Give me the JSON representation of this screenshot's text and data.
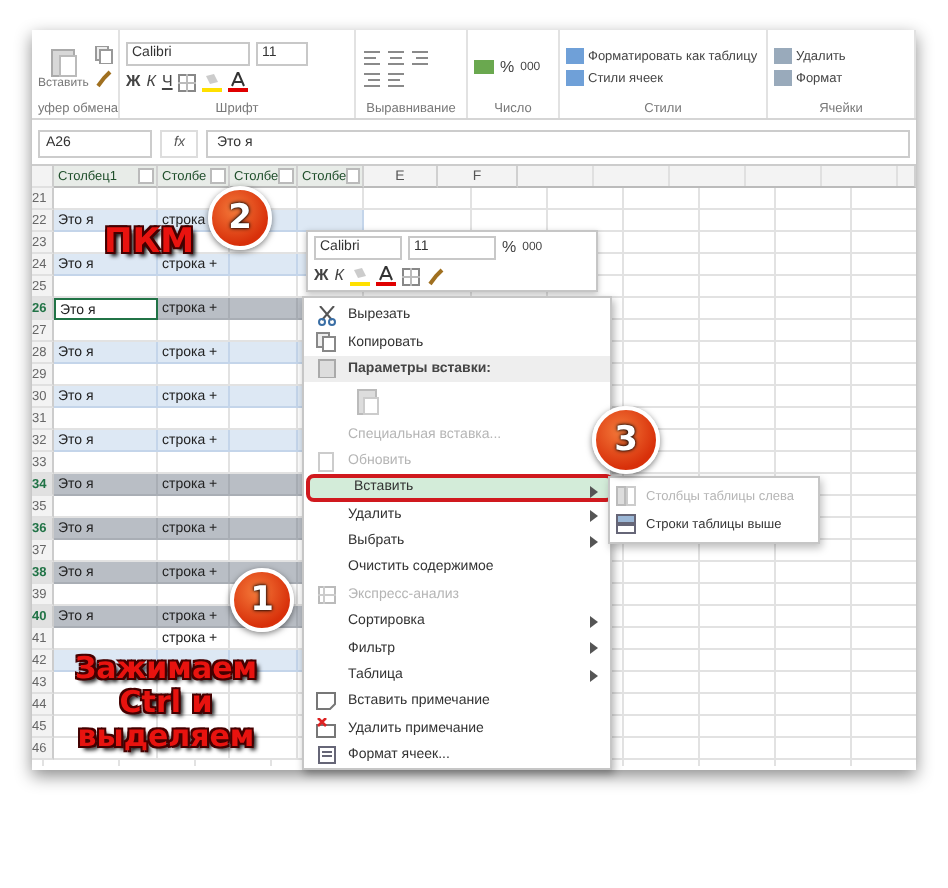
{
  "ribbon": {
    "clipboard": {
      "paste": "Вставить",
      "group": "уфер обмена"
    },
    "font": {
      "name": "Calibri",
      "size": "11",
      "bold": "Ж",
      "italic": "К",
      "underline": "Ч",
      "group": "Шрифт"
    },
    "alignment": {
      "group": "Выравнивание"
    },
    "number": {
      "percent": "%",
      "thousands": "000",
      "group": "Число"
    },
    "styles": {
      "items": [
        "Форматировать как таблицу",
        "Стили ячеек"
      ],
      "group": "Стили"
    },
    "cells": {
      "items": [
        "Удалить",
        "Формат"
      ],
      "group": "Ячейки"
    }
  },
  "formula_bar": {
    "name_box": "A26",
    "fx": "fx",
    "value": "Это я"
  },
  "sheet": {
    "columns": [
      {
        "label": "Столбец1",
        "filter": true
      },
      {
        "label": "Столбе",
        "filter": true
      },
      {
        "label": "Столбе",
        "filter": true
      },
      {
        "label": "Столбе",
        "filter": true
      },
      {
        "label": "E",
        "filter": false
      },
      {
        "label": "F",
        "filter": false
      }
    ],
    "rows": [
      {
        "number": "21",
        "cells": [
          "",
          ""
        ],
        "band": false,
        "selected": false,
        "active": false
      },
      {
        "number": "22",
        "cells": [
          "Это я",
          "строка"
        ],
        "band": true,
        "selected": false,
        "active": false
      },
      {
        "number": "23",
        "cells": [
          "",
          ""
        ],
        "band": false,
        "selected": false,
        "active": false
      },
      {
        "number": "24",
        "cells": [
          "Это я",
          "строка +"
        ],
        "band": true,
        "selected": false,
        "active": false
      },
      {
        "number": "25",
        "cells": [
          "",
          ""
        ],
        "band": false,
        "selected": false,
        "active": false
      },
      {
        "number": "26",
        "cells": [
          "Это я",
          "строка +"
        ],
        "band": true,
        "selected": true,
        "active": true
      },
      {
        "number": "27",
        "cells": [
          "",
          ""
        ],
        "band": false,
        "selected": false,
        "active": false
      },
      {
        "number": "28",
        "cells": [
          "Это я",
          "строка +"
        ],
        "band": true,
        "selected": false,
        "active": false
      },
      {
        "number": "29",
        "cells": [
          "",
          ""
        ],
        "band": false,
        "selected": false,
        "active": false
      },
      {
        "number": "30",
        "cells": [
          "Это я",
          "строка +"
        ],
        "band": true,
        "selected": false,
        "active": false
      },
      {
        "number": "31",
        "cells": [
          "",
          ""
        ],
        "band": false,
        "selected": false,
        "active": false
      },
      {
        "number": "32",
        "cells": [
          "Это я",
          "строка +"
        ],
        "band": true,
        "selected": false,
        "active": false
      },
      {
        "number": "33",
        "cells": [
          "",
          ""
        ],
        "band": false,
        "selected": false,
        "active": false
      },
      {
        "number": "34",
        "cells": [
          "Это я",
          "строка +"
        ],
        "band": true,
        "selected": true,
        "active": false
      },
      {
        "number": "35",
        "cells": [
          "",
          ""
        ],
        "band": false,
        "selected": false,
        "active": false
      },
      {
        "number": "36",
        "cells": [
          "Это я",
          "строка +"
        ],
        "band": true,
        "selected": true,
        "active": false
      },
      {
        "number": "37",
        "cells": [
          "",
          ""
        ],
        "band": false,
        "selected": false,
        "active": false
      },
      {
        "number": "38",
        "cells": [
          "Это я",
          "строка +"
        ],
        "band": true,
        "selected": true,
        "active": false
      },
      {
        "number": "39",
        "cells": [
          "",
          ""
        ],
        "band": false,
        "selected": false,
        "active": false
      },
      {
        "number": "40",
        "cells": [
          "Это я",
          "строка +"
        ],
        "band": true,
        "selected": true,
        "active": false
      },
      {
        "number": "41",
        "cells": [
          "",
          "строка +"
        ],
        "band": false,
        "selected": false,
        "active": false
      },
      {
        "number": "42",
        "cells": [
          "",
          ""
        ],
        "band": true,
        "selected": false,
        "active": false
      },
      {
        "number": "43",
        "cells": [
          "",
          ""
        ],
        "band": false,
        "selected": false,
        "active": false
      },
      {
        "number": "44",
        "cells": [
          "",
          ""
        ],
        "band": false,
        "selected": false,
        "active": false
      },
      {
        "number": "45",
        "cells": [
          "",
          ""
        ],
        "band": false,
        "selected": false,
        "active": false
      },
      {
        "number": "46",
        "cells": [
          "",
          ""
        ],
        "band": false,
        "selected": false,
        "active": false
      }
    ]
  },
  "mini_toolbar": {
    "font": "Calibri",
    "size": "11",
    "bold": "Ж",
    "italic": "К",
    "percent": "%",
    "thousands": "000"
  },
  "context_menu": [
    {
      "kind": "item",
      "label": "Вырезать",
      "disabled": false,
      "selected": false,
      "submenu": false
    },
    {
      "kind": "item",
      "label": "Копировать",
      "disabled": false,
      "selected": false,
      "submenu": false
    },
    {
      "kind": "header",
      "label": "Параметры вставки:"
    },
    {
      "kind": "paste-options"
    },
    {
      "kind": "item",
      "label": "Специальная вставка...",
      "disabled": true,
      "selected": false,
      "submenu": false
    },
    {
      "kind": "item",
      "label": "Обновить",
      "disabled": true,
      "selected": false,
      "submenu": false
    },
    {
      "kind": "item",
      "label": "Вставить",
      "disabled": false,
      "selected": true,
      "submenu": true
    },
    {
      "kind": "item",
      "label": "Удалить",
      "disabled": false,
      "selected": false,
      "submenu": true
    },
    {
      "kind": "item",
      "label": "Выбрать",
      "disabled": false,
      "selected": false,
      "submenu": true
    },
    {
      "kind": "item",
      "label": "Очистить содержимое",
      "disabled": false,
      "selected": false,
      "submenu": false
    },
    {
      "kind": "item",
      "label": "Экспресс-анализ",
      "disabled": true,
      "selected": false,
      "submenu": false
    },
    {
      "kind": "item",
      "label": "Сортировка",
      "disabled": false,
      "selected": false,
      "submenu": true
    },
    {
      "kind": "item",
      "label": "Фильтр",
      "disabled": false,
      "selected": false,
      "submenu": true
    },
    {
      "kind": "item",
      "label": "Таблица",
      "disabled": false,
      "selected": false,
      "submenu": true
    },
    {
      "kind": "item",
      "label": "Вставить примечание",
      "disabled": false,
      "selected": false,
      "submenu": false
    },
    {
      "kind": "item",
      "label": "Удалить примечание",
      "disabled": false,
      "selected": false,
      "submenu": false
    },
    {
      "kind": "item",
      "label": "Формат ячеек...",
      "disabled": false,
      "selected": false,
      "submenu": false
    }
  ],
  "submenu": [
    {
      "label": "Столбцы таблицы слева",
      "disabled": true
    },
    {
      "label": "Строки таблицы выше",
      "disabled": false
    }
  ],
  "annotations": {
    "badges": [
      "2",
      "3",
      "1"
    ],
    "captions": [
      "ПКМ",
      "Зажимаем Ctrl и выделяем"
    ]
  }
}
